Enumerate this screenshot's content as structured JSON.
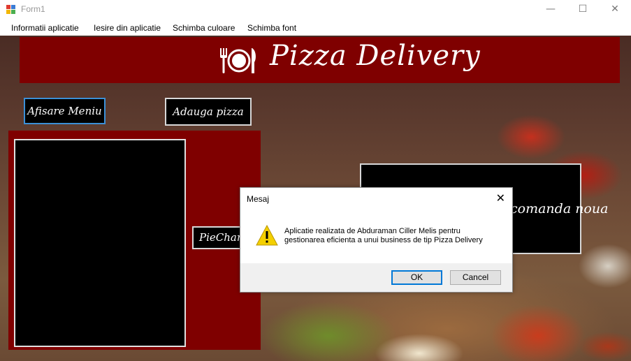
{
  "window": {
    "title": "Form1",
    "minimize_glyph": "—",
    "maximize_glyph": "☐",
    "close_glyph": "✕"
  },
  "menu": {
    "items": [
      "Informatii aplicatie",
      "Iesire din aplicatie",
      "Schimba culoare",
      "Schimba font"
    ]
  },
  "banner": {
    "title": "Pizza Delivery",
    "icon": "fork-plate-knife-icon"
  },
  "buttons": {
    "show_menu": "Afisare Meniu",
    "add_pizza": "Adauga pizza",
    "pie_chart": "PieChart",
    "right_label": "comanda noua"
  },
  "dialog": {
    "title": "Mesaj",
    "close_glyph": "✕",
    "icon": "warning-icon",
    "message_line1": "Aplicatie realizata de Abduraman Ciller Melis pentru",
    "message_line2": "gestionarea eficienta a unui business de tip Pizza Delivery",
    "ok_label": "OK",
    "cancel_label": "Cancel"
  },
  "colors": {
    "banner": "#7f0000",
    "dialog_default_border": "#0078d7",
    "warning_yellow": "#f4d000"
  }
}
